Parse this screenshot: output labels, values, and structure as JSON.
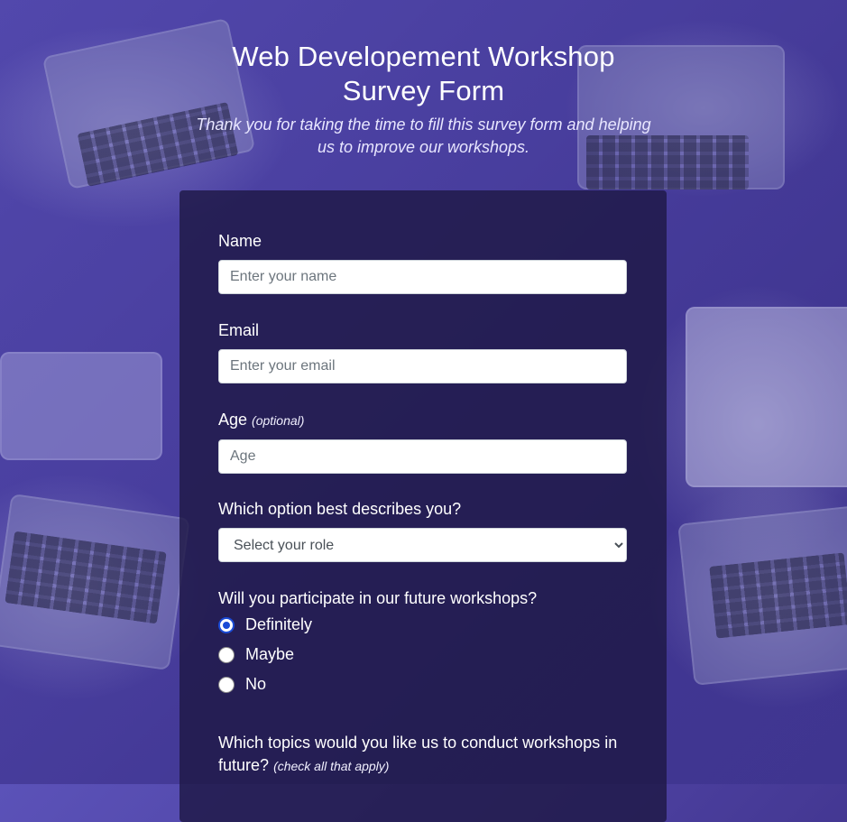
{
  "page": {
    "title": "Web Developement Workshop Survey Form",
    "description": "Thank you for taking the time to fill this survey form and helping us to improve our workshops."
  },
  "form": {
    "name": {
      "label": "Name",
      "placeholder": "Enter your name"
    },
    "email": {
      "label": "Email",
      "placeholder": "Enter your email"
    },
    "age": {
      "label": "Age",
      "hint": "(optional)",
      "placeholder": "Age"
    },
    "role": {
      "label": "Which option best describes you?",
      "selected": "Select your role"
    },
    "participate": {
      "label": "Will you participate in our future workshops?",
      "options": [
        {
          "label": "Definitely",
          "checked": true
        },
        {
          "label": "Maybe",
          "checked": false
        },
        {
          "label": "No",
          "checked": false
        }
      ]
    },
    "topics": {
      "label": "Which topics would you like us to conduct workshops in future?",
      "hint": "(check all that apply)"
    }
  },
  "colors": {
    "accent": "#1a4bd6",
    "card": "#1e1846",
    "overlay": "#5046a8"
  }
}
